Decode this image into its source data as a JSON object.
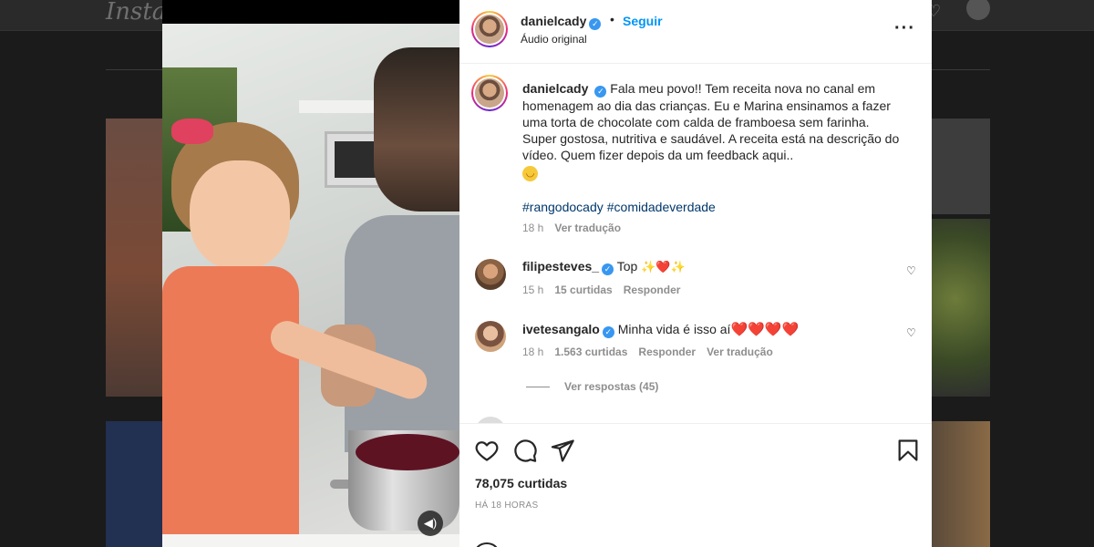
{
  "background": {
    "logo": "Instagram"
  },
  "post": {
    "author": {
      "username": "danielcady",
      "verified": true,
      "follow_label": "Seguir",
      "subtitle": "Áudio original"
    },
    "caption": {
      "text": "Fala meu povo!! Tem receita nova no canal em homenagem ao dia das crianças. Eu e Marina ensinamos a fazer uma torta de chocolate com calda de framboesa sem farinha. Super gostosa, nutritiva e saudável. A receita está na descrição do vídeo. Quem fizer depois da um feedback aqui..",
      "emoji": "😋",
      "hashtags": [
        "#rangodocady",
        "#comidadeverdade"
      ],
      "time": "18 h",
      "translate_label": "Ver tradução"
    },
    "comments": [
      {
        "username": "filipesteves_",
        "verified": true,
        "text": "Top",
        "emoji_suffix": "✨❤️✨",
        "time": "15 h",
        "likes": "15 curtidas",
        "reply_label": "Responder"
      },
      {
        "username": "ivetesangalo",
        "verified": true,
        "text": "Minha vida é isso aí",
        "emoji_suffix": "❤️❤️❤️❤️",
        "time": "18 h",
        "likes": "1.563 curtidas",
        "reply_label": "Responder",
        "translate_label": "Ver tradução"
      }
    ],
    "view_replies_label": "Ver respostas (45)",
    "likes_count": "78,075 curtidas",
    "timestamp": "HÁ 18 HORAS"
  },
  "icons": {
    "like": "heart-icon",
    "comment": "comment-icon",
    "share": "send-icon",
    "save": "bookmark-icon",
    "more": "more-icon",
    "mute": "speaker-icon",
    "verified": "verified-badge-icon"
  },
  "colors": {
    "link_blue": "#0095f6",
    "hashtag": "#00376b",
    "secondary_text": "#8e8e8e",
    "heart_red": "#ed4956"
  }
}
